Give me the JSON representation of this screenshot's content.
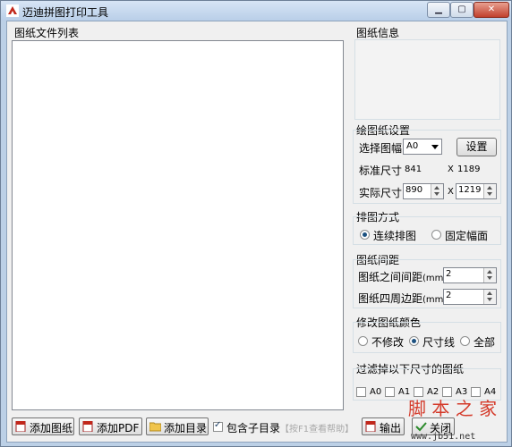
{
  "window": {
    "title": "迈迪拼图打印工具",
    "colors": {
      "chrome": "#bcd0e6",
      "client": "#f0f0f0",
      "accent": "#1c5180"
    }
  },
  "file_list": {
    "label": "图纸文件列表"
  },
  "info": {
    "label": "图纸信息"
  },
  "settings": {
    "label": "绘图纸设置",
    "select_label": "选择图幅",
    "size_value": "A0",
    "set_button": "设置",
    "standard_label": "标准尺寸",
    "standard_w": "841",
    "x1": "X",
    "standard_h": "1189",
    "actual_label": "实际尺寸",
    "actual_w": "890",
    "x2": "X",
    "actual_h": "1219"
  },
  "layout": {
    "label": "排图方式",
    "opt_continuous": "连续排图",
    "opt_fixed": "固定幅面",
    "selected": "continuous"
  },
  "spacing": {
    "label": "图纸间距",
    "between_label": "图纸之间间距",
    "between_unit": "(mm)",
    "between_value": "2",
    "border_label": "图纸四周边距",
    "border_unit": "(mm)",
    "border_value": "2"
  },
  "color": {
    "label": "修改图纸颜色",
    "opt_none": "不修改",
    "opt_dim": "尺寸线",
    "opt_all": "全部",
    "selected": "dim"
  },
  "filter": {
    "label": "过滤掉以下尺寸的图纸",
    "items": [
      "A0",
      "A1",
      "A2",
      "A3",
      "A4"
    ]
  },
  "toolbar": {
    "add_drawing": "添加图纸",
    "add_pdf": "添加PDF",
    "add_dir": "添加目录",
    "include_sub": "包含子目录",
    "include_sub_checked": true,
    "help_hint": "【按F1查看帮助】",
    "output": "输出",
    "close": "关闭"
  },
  "watermark": {
    "main": "脚 本 之 家",
    "url": "www.jb51.net"
  },
  "icons": [
    "app-icon",
    "minimize-icon",
    "maximize-icon",
    "close-icon",
    "dropdown-arrow-icon",
    "spin-up-icon",
    "spin-down-icon",
    "pdf-icon",
    "folder-icon",
    "printer-icon",
    "check-icon"
  ]
}
